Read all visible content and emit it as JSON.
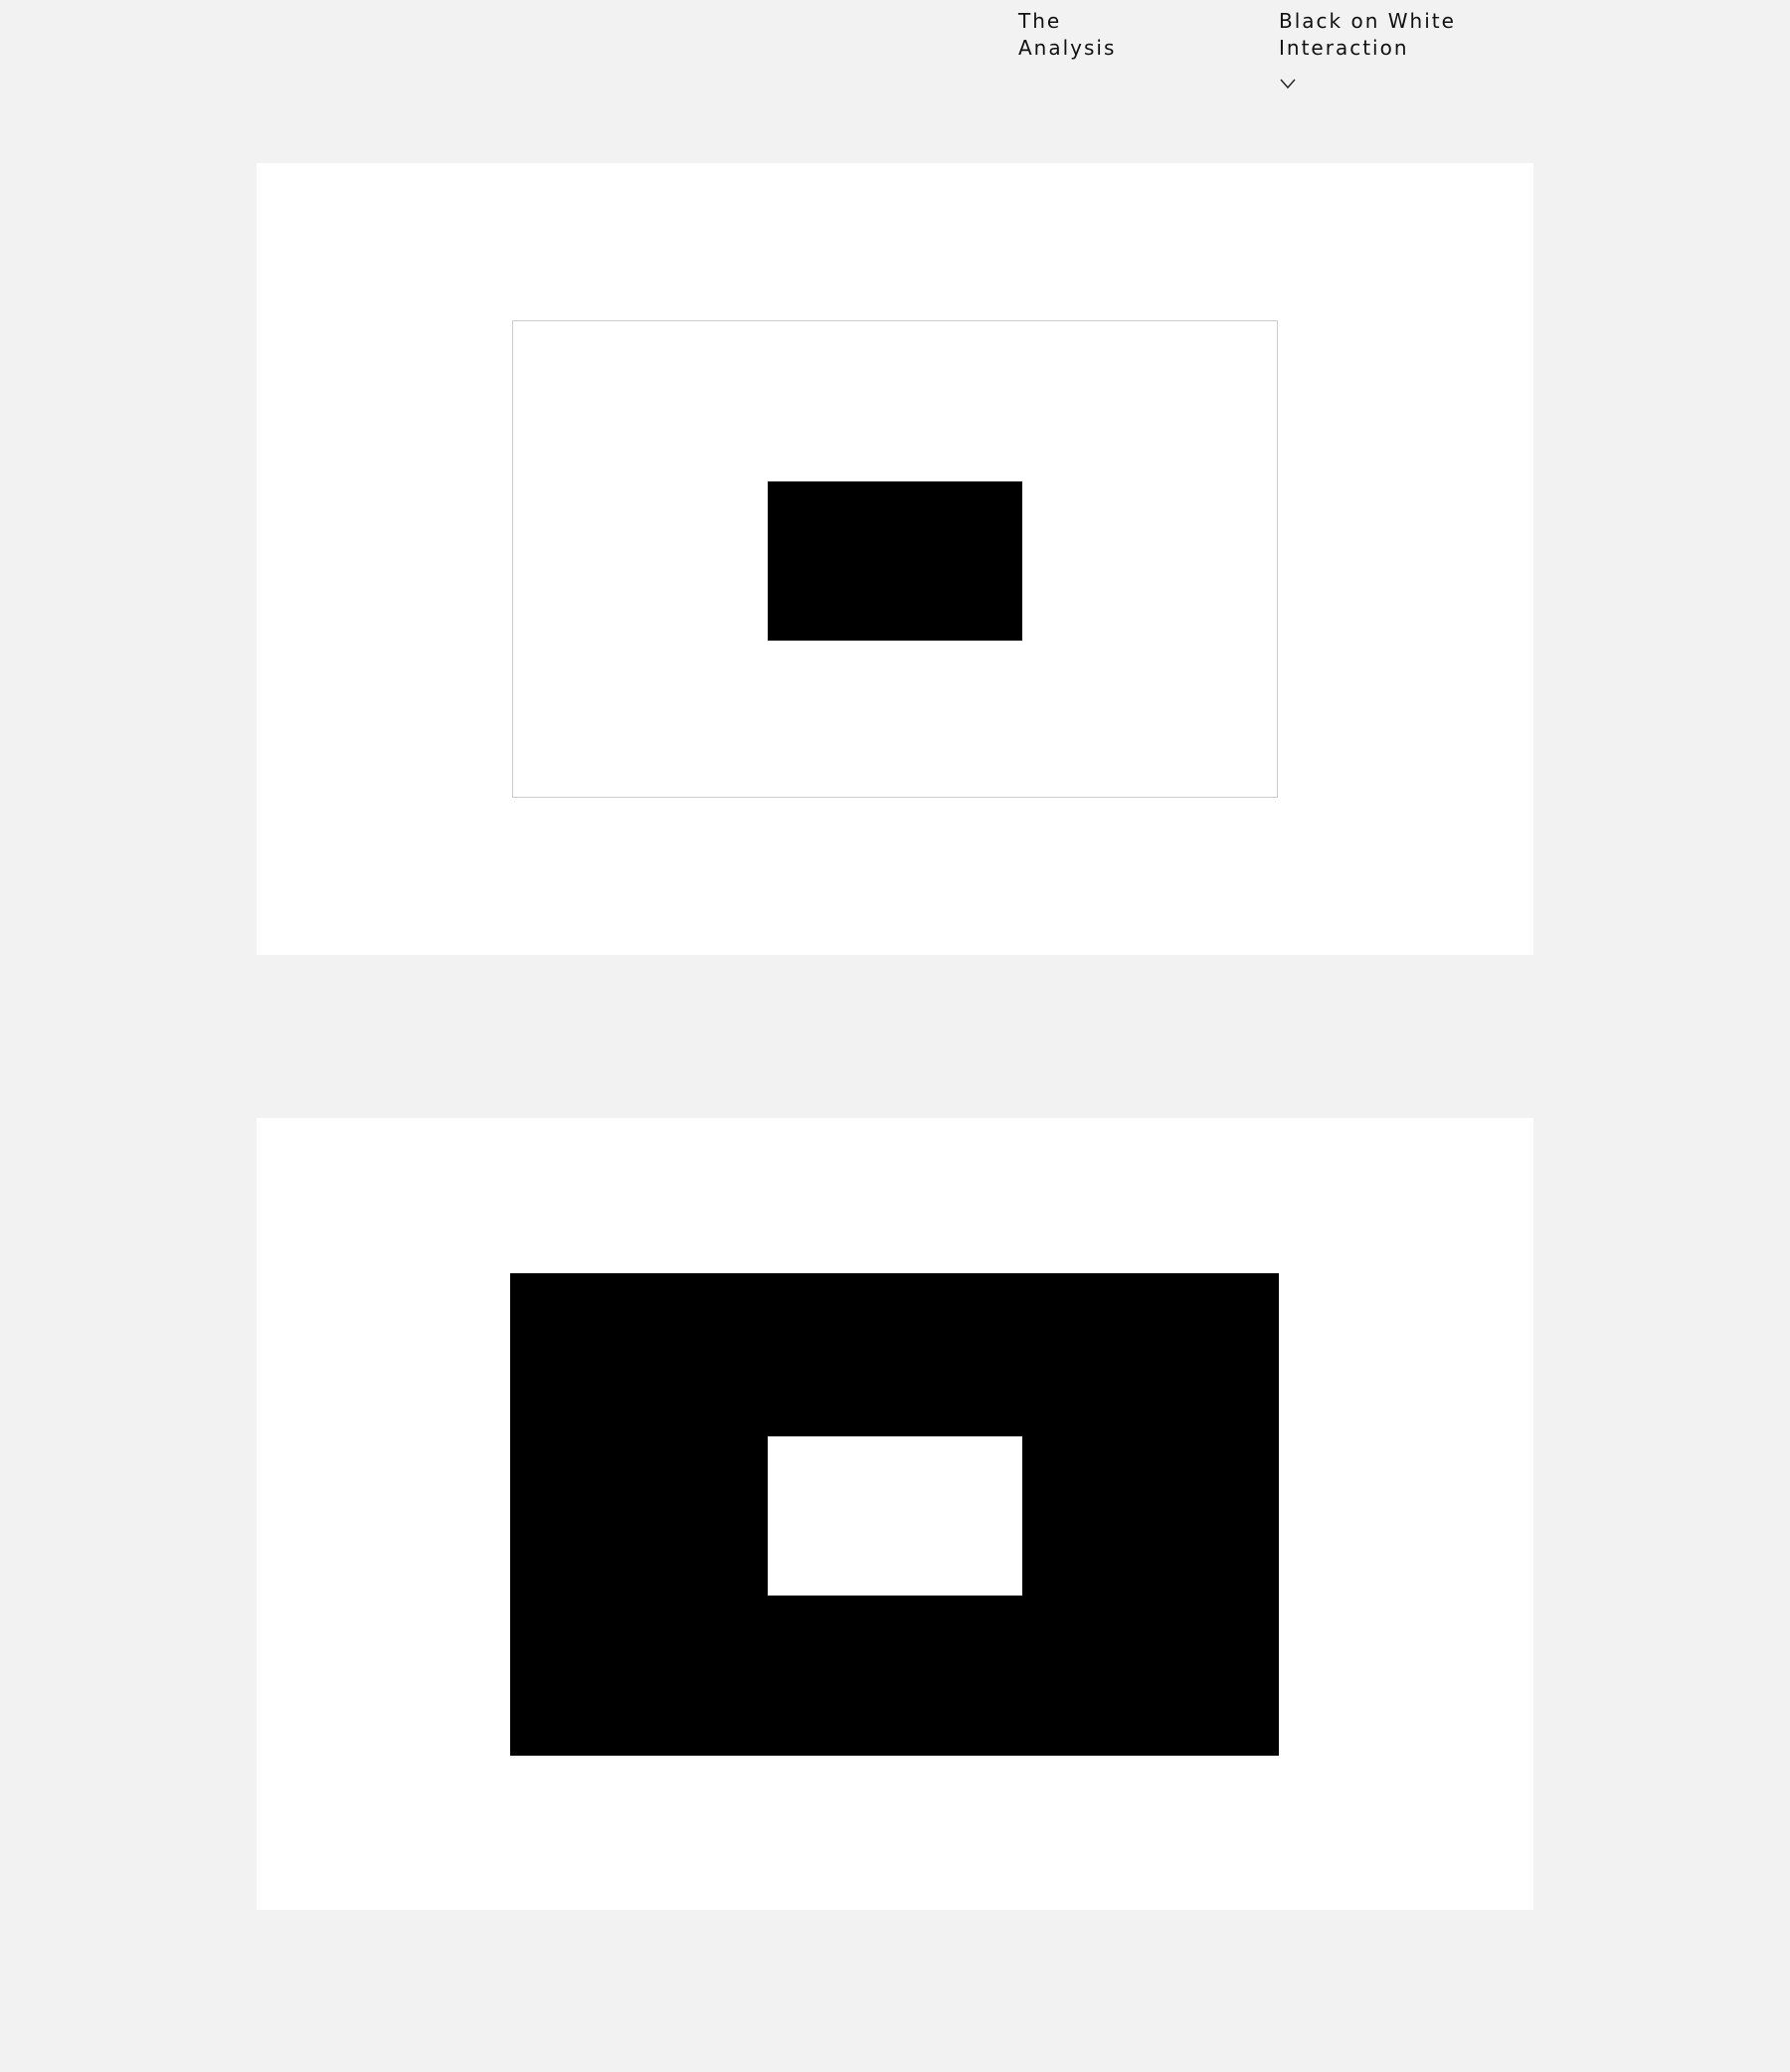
{
  "nav": {
    "analysis": {
      "line1": "The",
      "line2": "Analysis"
    },
    "interaction": {
      "line1": "Black on White",
      "line2": "Interaction",
      "toggle_icon": "chevron-down-icon"
    }
  },
  "colors": {
    "page_background": "#f2f2f2",
    "panel_background": "#ffffff",
    "black": "#000000",
    "outline": "#cccccc"
  }
}
